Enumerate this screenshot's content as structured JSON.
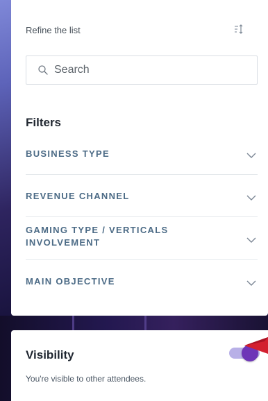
{
  "refine": {
    "title": "Refine the list",
    "search": {
      "placeholder": "Search",
      "value": ""
    },
    "sort_icon": "sort-icon",
    "search_icon": "search-icon"
  },
  "filters": {
    "title": "Filters",
    "items": [
      {
        "label": "BUSINESS TYPE"
      },
      {
        "label": "REVENUE CHANNEL"
      },
      {
        "label": "GAMING TYPE / VERTICALS INVOLVEMENT"
      },
      {
        "label": "MAIN OBJECTIVE"
      }
    ],
    "chevron_icon": "chevron-down-icon"
  },
  "visibility": {
    "title": "Visibility",
    "description": "You're visible to other attendees.",
    "enabled": true,
    "toggle_icon": "toggle-switch"
  },
  "colors": {
    "accent": "#6e35b7",
    "toggle_track": "#b8b0e7",
    "filter_label": "#4c6b86",
    "text": "#222831"
  }
}
